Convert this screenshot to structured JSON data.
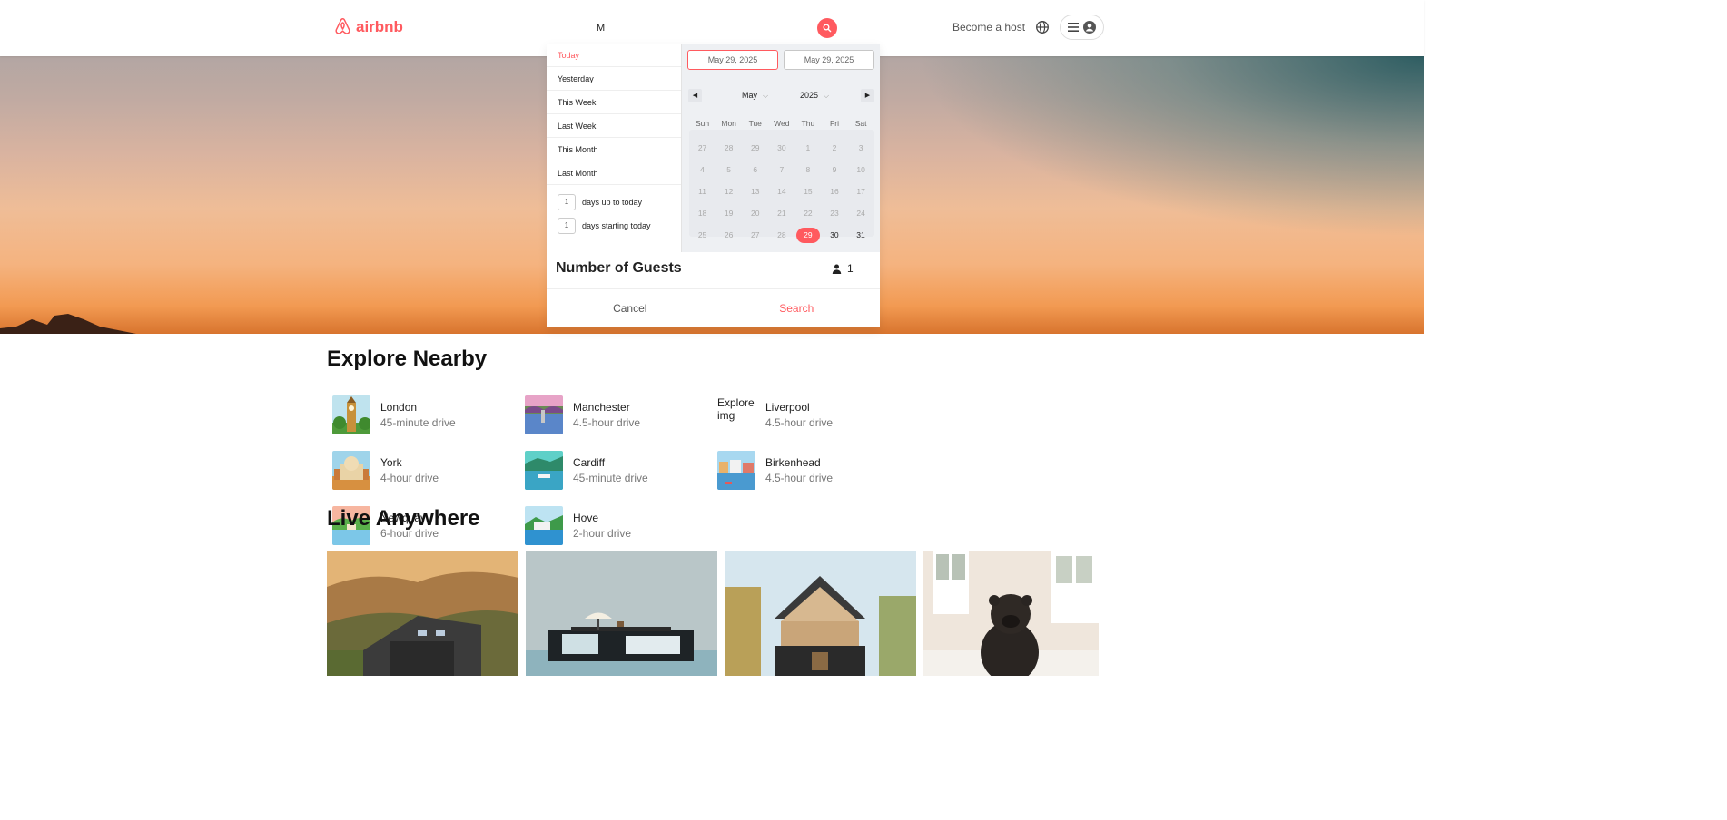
{
  "header": {
    "logo_text": "airbnb",
    "search_value": "M",
    "become_host": "Become a host",
    "brand_color": "#ff5a5f"
  },
  "datepicker": {
    "ranges": [
      "Today",
      "Yesterday",
      "This Week",
      "Last Week",
      "This Month",
      "Last Month"
    ],
    "active_range": "Today",
    "days_up_to_today": {
      "value": "1",
      "label": "days up to today"
    },
    "days_starting_today": {
      "value": "1",
      "label": "days starting today"
    },
    "start_date": "May 29, 2025",
    "end_date": "May 29, 2025",
    "month": "May",
    "year": "2025",
    "weekdays": [
      "Sun",
      "Mon",
      "Tue",
      "Wed",
      "Thu",
      "Fri",
      "Sat"
    ],
    "weeks": [
      [
        "27",
        "28",
        "29",
        "30",
        "1",
        "2",
        "3"
      ],
      [
        "4",
        "5",
        "6",
        "7",
        "8",
        "9",
        "10"
      ],
      [
        "11",
        "12",
        "13",
        "14",
        "15",
        "16",
        "17"
      ],
      [
        "18",
        "19",
        "20",
        "21",
        "22",
        "23",
        "24"
      ],
      [
        "25",
        "26",
        "27",
        "28",
        "29",
        "30",
        "31"
      ]
    ],
    "selected_day": "29"
  },
  "guests": {
    "title": "Number of Guests",
    "count": "1"
  },
  "actions": {
    "cancel": "Cancel",
    "search": "Search"
  },
  "explore": {
    "title": "Explore Nearby",
    "items": [
      {
        "city": "London",
        "drive": "45-minute drive"
      },
      {
        "city": "Manchester",
        "drive": "4.5-hour drive"
      },
      {
        "city": "Liverpool",
        "drive": "4.5-hour drive",
        "broken_alt": "Explore img"
      },
      {
        "city": "York",
        "drive": "4-hour drive"
      },
      {
        "city": "Cardiff",
        "drive": "45-minute drive"
      },
      {
        "city": "Birkenhead",
        "drive": "4.5-hour drive"
      },
      {
        "city": "Newquay",
        "drive": "6-hour drive"
      },
      {
        "city": "Hove",
        "drive": "2-hour drive"
      }
    ]
  },
  "live": {
    "title": "Live Anywhere"
  }
}
